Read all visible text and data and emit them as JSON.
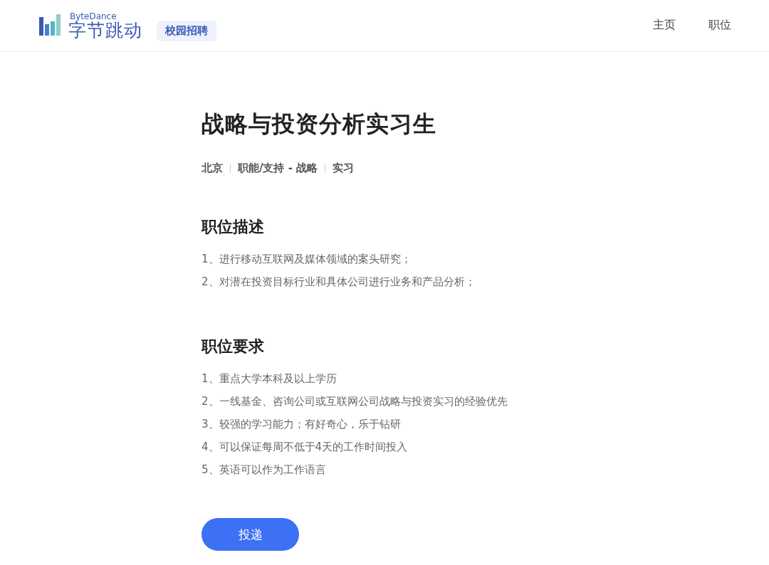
{
  "header": {
    "logo": {
      "brand_en": "ByteDance",
      "brand_cn": "字节跳动",
      "badge": "校园招聘"
    },
    "nav": [
      {
        "label": "主页"
      },
      {
        "label": "职位"
      }
    ]
  },
  "job": {
    "title": "战略与投资分析实习生",
    "meta": [
      "北京",
      "职能/支持 - 战略",
      "实习"
    ],
    "sections": [
      {
        "heading": "职位描述",
        "items": [
          "1、进行移动互联网及媒体领域的案头研究；",
          "2、对潜在投资目标行业和具体公司进行业务和产品分析；"
        ]
      },
      {
        "heading": "职位要求",
        "items": [
          "1、重点大学本科及以上学历",
          "2、一线基金、咨询公司或互联网公司战略与投资实习的经验优先",
          "3、较强的学习能力；有好奇心，乐于钻研",
          "4、可以保证每周不低于4天的工作时间投入",
          "5、英语可以作为工作语言"
        ]
      }
    ],
    "apply_button": "投递"
  }
}
